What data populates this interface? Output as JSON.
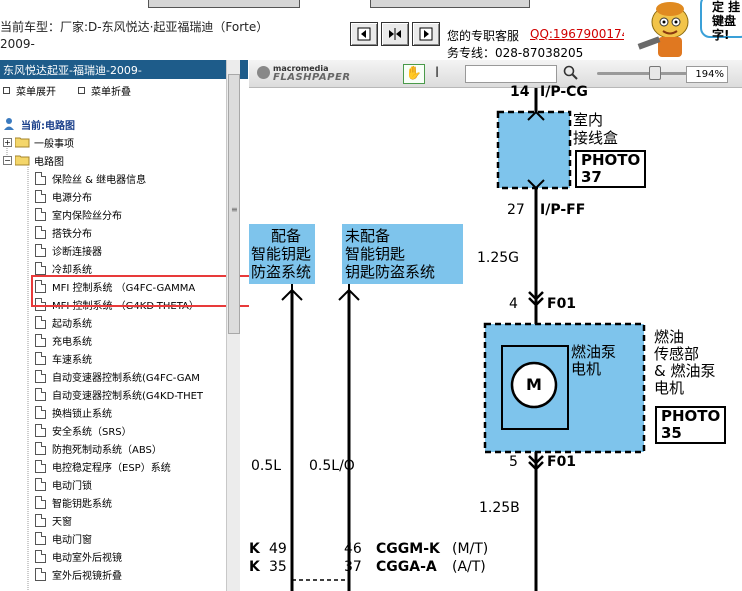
{
  "header": {
    "vehicle_line1": "当前车型：厂家:D-东风悦达·起亚福瑞迪（Forte）",
    "vehicle_line2": "2009-",
    "support_label": "您的专职客服",
    "support_qq": "QQ:1967900174",
    "support_phone": "务专线：028-87038205",
    "bubble_text": "定 挂 键盘 字!"
  },
  "left_panel": {
    "title": "东风悦达起亚-福瑞迪-2009-",
    "expand_all": "菜单展开",
    "collapse_all": "菜单折叠",
    "current_label": "当前:电路图",
    "general": "一般事项",
    "circuit": "电路图",
    "items": [
      "保险丝 & 继电器信息",
      "电源分布",
      "室内保险丝分布",
      "搭铁分布",
      "诊断连接器",
      "冷却系统",
      "MFI 控制系统 （G4FC-GAMMA",
      "MFI 控制系统 （G4KD-THETA）",
      "起动系统",
      "充电系统",
      "车速系统",
      "自动变速器控制系统(G4FC-GAM",
      "自动变速器控制系统(G4KD-THET",
      "换档锁止系统",
      "安全系统（SRS）",
      "防抱死制动系统（ABS）",
      "电控稳定程序（ESP）系统",
      "电动门锁",
      "智能钥匙系统",
      "天窗",
      "电动门窗",
      "电动室外后视镜",
      "室外后视镜折叠"
    ]
  },
  "viewer": {
    "logo_top": "macromedia",
    "logo_bottom": "FLASHPAPER",
    "zoom": "194%"
  },
  "diagram": {
    "top_pin": "14",
    "top_conn": "I/P-CG",
    "junction_label1": "室内",
    "junction_label2": "接线盒",
    "photo37": "PHOTO  37",
    "pin27": "27",
    "conn_ipff": "I/P-FF",
    "wire_125g": "1.25G",
    "pin4": "4",
    "conn_f01_top": "F01",
    "pump_label1": "燃油泵",
    "pump_label2": "电机",
    "side_label1": "燃油",
    "side_label2": "传感部",
    "side_label3": "& 燃油泵",
    "side_label4": "电机",
    "photo35_a": "PHOTO",
    "photo35_b": "35",
    "motor_letter": "M",
    "pin5": "5",
    "conn_f01_bot": "F01",
    "wire_125b": "1.25B",
    "opt1_line1": "配备",
    "opt1_line2": "智能钥匙",
    "opt1_line3": "防盗系统",
    "opt2_line1": "未配备",
    "opt2_line2": "智能钥匙",
    "opt2_line3": "钥匙防盗系统",
    "wire_05l": "0.5L",
    "wire_05lo": "0.5L/O",
    "row1_k": "K",
    "row1_pin_a": "49",
    "row1_pin_b": "46",
    "row1_conn": "CGGM-K",
    "row1_suffix": "(M/T)",
    "row2_k": "K",
    "row2_pin_a": "35",
    "row2_pin_b": "37",
    "row2_conn": "CGGA-A",
    "row2_suffix": "(A/T)"
  },
  "colors": {
    "title_bar": "#1e5c8a",
    "highlight": "#e83a3a",
    "diagram_fill": "#7ec4ec",
    "qq_red": "#d00000"
  }
}
